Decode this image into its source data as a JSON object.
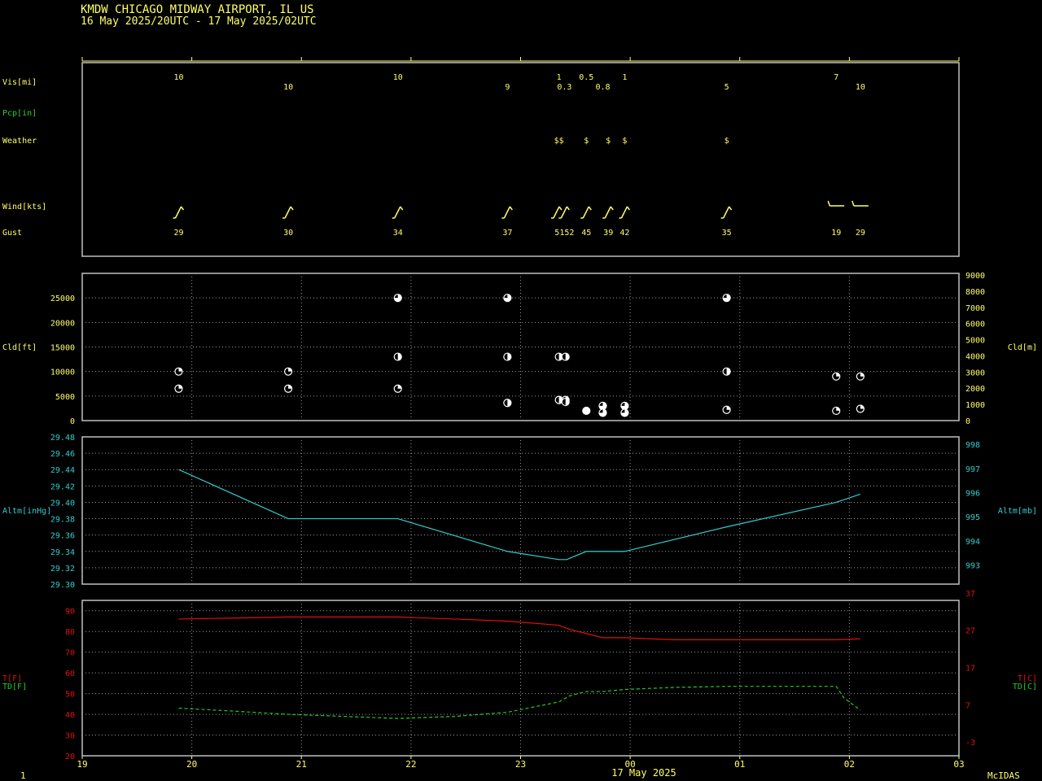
{
  "header": {
    "station_line": "KMDW  CHICAGO MIDWAY AIRPORT, IL US",
    "period_line": "16 May 2025/20UTC - 17 May 2025/02UTC"
  },
  "footer": {
    "page_number": "1",
    "date_label": "17 May 2025",
    "brand": "McIDAS"
  },
  "colors": {
    "text": "#ffff66",
    "frame": "#c0c0c0",
    "grid": "#9a9a9a",
    "pcp": "#33cc33",
    "altimeter": "#33cccc",
    "temperature": "#dd1111",
    "dewpoint": "#22cc22",
    "cloud": "#ffffff"
  },
  "labels": {
    "vis": "Vis[mi]",
    "pcp": "Pcp[in]",
    "weather": "Weather",
    "wind": "Wind[kts]",
    "gust": "Gust",
    "cld_ft": "Cld[ft]",
    "cld_m": "Cld[m]",
    "altm_inhg": "Altm[inHg]",
    "altm_mb": "Altm[mb]",
    "t_f": "T[F]",
    "td_f": "TD[F]",
    "t_c": "T[C]",
    "td_c": "TD[C]"
  },
  "chart_data": [
    {
      "type": "table",
      "panel": "surface_obs",
      "x_range": [
        19,
        27
      ],
      "visibility": [
        {
          "x": 19.88,
          "value": "10"
        },
        {
          "x": 20.88,
          "value": "10"
        },
        {
          "x": 21.88,
          "value": "10"
        },
        {
          "x": 22.88,
          "value": "9"
        },
        {
          "x": 23.35,
          "value": "1"
        },
        {
          "x": 23.4,
          "value": "0.3"
        },
        {
          "x": 23.6,
          "value": "0.5"
        },
        {
          "x": 23.75,
          "value": "0.8"
        },
        {
          "x": 23.95,
          "value": "1"
        },
        {
          "x": 24.88,
          "value": "5"
        },
        {
          "x": 25.88,
          "value": "7"
        },
        {
          "x": 26.1,
          "value": "10"
        }
      ],
      "weather": [
        {
          "x": 23.35,
          "value": "$$"
        },
        {
          "x": 23.6,
          "value": "$"
        },
        {
          "x": 23.8,
          "value": "$"
        },
        {
          "x": 23.95,
          "value": "$"
        },
        {
          "x": 24.88,
          "value": "$"
        }
      ],
      "wind_barbs": [
        {
          "x": 19.88,
          "dir": 200
        },
        {
          "x": 20.88,
          "dir": 160
        },
        {
          "x": 21.88,
          "dir": 220
        },
        {
          "x": 22.88,
          "dir": 220
        },
        {
          "x": 23.33,
          "dir": 200
        },
        {
          "x": 23.4,
          "dir": 200
        },
        {
          "x": 23.6,
          "dir": 200
        },
        {
          "x": 23.8,
          "dir": 200
        },
        {
          "x": 23.95,
          "dir": 200
        },
        {
          "x": 24.88,
          "dir": 220
        },
        {
          "x": 25.88,
          "dir": 270
        },
        {
          "x": 26.1,
          "dir": 260
        }
      ],
      "gusts": [
        {
          "x": 19.88,
          "value": "29"
        },
        {
          "x": 20.88,
          "value": "30"
        },
        {
          "x": 21.88,
          "value": "34"
        },
        {
          "x": 22.88,
          "value": "37"
        },
        {
          "x": 23.4,
          "value": "5152"
        },
        {
          "x": 23.6,
          "value": "45"
        },
        {
          "x": 23.8,
          "value": "39"
        },
        {
          "x": 23.95,
          "value": "42"
        },
        {
          "x": 24.88,
          "value": "35"
        },
        {
          "x": 25.88,
          "value": "19"
        },
        {
          "x": 26.1,
          "value": "29"
        }
      ]
    },
    {
      "type": "scatter",
      "panel": "cloud_heights",
      "ylabel": "Cld[ft]",
      "ylabel_right": "Cld[m]",
      "ylim": [
        0,
        30000
      ],
      "yticks_left": [
        "0",
        "5000",
        "10000",
        "15000",
        "20000",
        "25000"
      ],
      "yticks_right": [
        "0",
        "1000",
        "2000",
        "3000",
        "4000",
        "5000",
        "6000",
        "7000",
        "8000",
        "9000"
      ],
      "points": [
        {
          "x": 19.88,
          "y": 10000,
          "cover": "few"
        },
        {
          "x": 19.88,
          "y": 6500,
          "cover": "few"
        },
        {
          "x": 20.88,
          "y": 10000,
          "cover": "few"
        },
        {
          "x": 20.88,
          "y": 6500,
          "cover": "few"
        },
        {
          "x": 21.88,
          "y": 25000,
          "cover": "bkn"
        },
        {
          "x": 21.88,
          "y": 13000,
          "cover": "sct"
        },
        {
          "x": 21.88,
          "y": 6500,
          "cover": "few"
        },
        {
          "x": 22.88,
          "y": 25000,
          "cover": "bkn"
        },
        {
          "x": 22.88,
          "y": 13000,
          "cover": "sct"
        },
        {
          "x": 22.88,
          "y": 3600,
          "cover": "sct"
        },
        {
          "x": 23.35,
          "y": 13000,
          "cover": "sct"
        },
        {
          "x": 23.41,
          "y": 13000,
          "cover": "sct"
        },
        {
          "x": 23.35,
          "y": 4200,
          "cover": "sct"
        },
        {
          "x": 23.41,
          "y": 4200,
          "cover": "sct"
        },
        {
          "x": 23.41,
          "y": 3800,
          "cover": "sct"
        },
        {
          "x": 23.6,
          "y": 2000,
          "cover": "ovc"
        },
        {
          "x": 23.75,
          "y": 3000,
          "cover": "bkn"
        },
        {
          "x": 23.75,
          "y": 1600,
          "cover": "bkn"
        },
        {
          "x": 23.95,
          "y": 3000,
          "cover": "bkn"
        },
        {
          "x": 23.95,
          "y": 1600,
          "cover": "bkn"
        },
        {
          "x": 24.88,
          "y": 25000,
          "cover": "bkn"
        },
        {
          "x": 24.88,
          "y": 10000,
          "cover": "sct"
        },
        {
          "x": 24.88,
          "y": 2200,
          "cover": "few"
        },
        {
          "x": 25.88,
          "y": 9000,
          "cover": "few"
        },
        {
          "x": 25.88,
          "y": 2000,
          "cover": "few"
        },
        {
          "x": 26.1,
          "y": 9000,
          "cover": "few"
        },
        {
          "x": 26.1,
          "y": 2400,
          "cover": "few"
        }
      ]
    },
    {
      "type": "line",
      "panel": "altimeter",
      "ylabel": "Altm[inHg]",
      "ylabel_right": "Altm[mb]",
      "ylim": [
        29.3,
        29.48
      ],
      "yticks_left": [
        "29.30",
        "29.32",
        "29.34",
        "29.36",
        "29.38",
        "29.40",
        "29.42",
        "29.44",
        "29.46",
        "29.48"
      ],
      "yticks_right": [
        "993",
        "994",
        "995",
        "996",
        "997",
        "998"
      ],
      "x": [
        19.88,
        20.88,
        21.88,
        22.88,
        23.35,
        23.42,
        23.6,
        23.95,
        24.88,
        25.88,
        26.1
      ],
      "values": [
        29.44,
        29.38,
        29.38,
        29.34,
        29.33,
        29.33,
        29.34,
        29.34,
        29.37,
        29.4,
        29.41
      ]
    },
    {
      "type": "line",
      "panel": "temperature",
      "ylim": [
        20,
        95
      ],
      "yticks_left": [
        "20",
        "30",
        "40",
        "50",
        "60",
        "70",
        "80",
        "90"
      ],
      "yticks_right": [
        "-3",
        "7",
        "17",
        "27",
        "37"
      ],
      "xticks": [
        "19",
        "20",
        "21",
        "22",
        "23",
        "00",
        "01",
        "02",
        "03"
      ],
      "series": [
        {
          "name": "T[F]",
          "x": [
            19.88,
            20.4,
            20.88,
            21.4,
            21.88,
            22.4,
            22.88,
            23.35,
            23.45,
            23.6,
            23.75,
            23.95,
            24.4,
            24.88,
            25.4,
            25.88,
            26.1
          ],
          "values": [
            86,
            86.5,
            87,
            87,
            87,
            86,
            85,
            83,
            81,
            79,
            77,
            77,
            76,
            76,
            76,
            76,
            76.5
          ]
        },
        {
          "name": "TD[F]",
          "x": [
            19.88,
            20.4,
            20.88,
            21.4,
            21.88,
            22.4,
            22.88,
            23.35,
            23.45,
            23.6,
            23.75,
            23.95,
            24.4,
            24.88,
            25.4,
            25.88,
            25.95,
            26.1
          ],
          "values": [
            43,
            41.5,
            40,
            39,
            38,
            39,
            41,
            46,
            49,
            51,
            51,
            52,
            53,
            53.5,
            53.5,
            53.5,
            48,
            42
          ]
        }
      ]
    }
  ]
}
